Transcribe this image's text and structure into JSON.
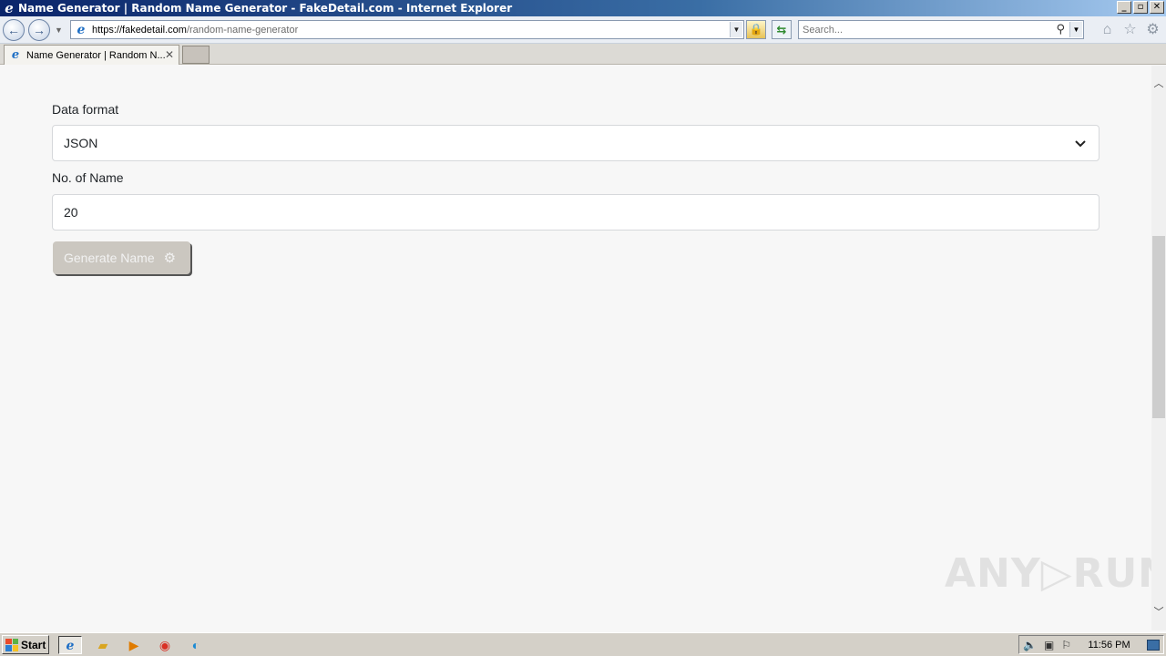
{
  "window": {
    "title": "Name Generator | Random Name Generator - FakeDetail.com - Internet Explorer",
    "controls": {
      "minimize": "_",
      "maximize": "▫",
      "close": "✕"
    }
  },
  "navigation": {
    "url_host": "https://fakedetail.com",
    "url_path": "/random-name-generator",
    "search_placeholder": "Search..."
  },
  "tabs": [
    {
      "label": "Name Generator | Random N...",
      "active": true
    }
  ],
  "form": {
    "data_format_label": "Data format",
    "data_format_value": "JSON",
    "count_label": "No. of Name",
    "count_value": "20",
    "generate_button": "Generate Name"
  },
  "watermark": "ANY▷RUN",
  "taskbar": {
    "start_label": "Start",
    "apps": [
      "internet-explorer-icon",
      "folder-icon",
      "media-player-icon",
      "chrome-icon",
      "edge-icon"
    ],
    "clock": "11:56 PM"
  },
  "colors": {
    "button_bg": "#cbc7c0",
    "titlebar": "#0a246a"
  }
}
